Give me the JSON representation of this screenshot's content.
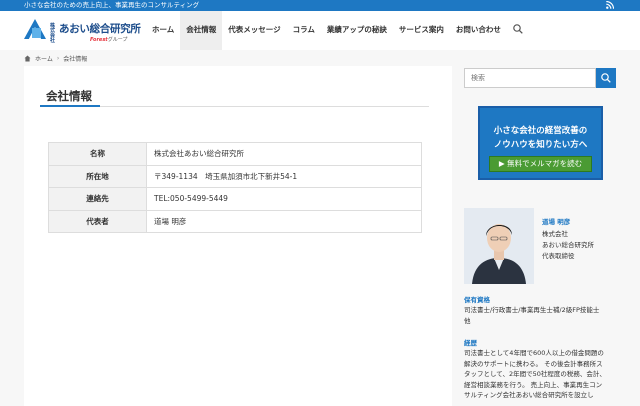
{
  "topbar": {
    "tagline": "小さな会社のための売上向上、事業再生のコンサルティング"
  },
  "logo": {
    "corp": "株式会社",
    "name": "あおい総合研究所",
    "group_brand": "Forest",
    "group_suffix": "グループ"
  },
  "nav": {
    "items": [
      {
        "label": "ホーム"
      },
      {
        "label": "会社情報",
        "active": true
      },
      {
        "label": "代表メッセージ"
      },
      {
        "label": "コラム"
      },
      {
        "label": "業績アップの秘訣"
      },
      {
        "label": "サービス案内"
      },
      {
        "label": "お問い合わせ"
      }
    ]
  },
  "breadcrumb": {
    "home": "ホーム",
    "current": "会社情報"
  },
  "page": {
    "title": "会社情報"
  },
  "info": {
    "rows": [
      {
        "key": "名称",
        "value": "株式会社あおい総合研究所"
      },
      {
        "key": "所在地",
        "value": "〒349-1134　埼玉県加須市北下新井54-1"
      },
      {
        "key": "連絡先",
        "value": "TEL:050-5499-5449"
      },
      {
        "key": "代表者",
        "value": "道場 明彦"
      }
    ]
  },
  "sidebar": {
    "search_placeholder": "検索",
    "banner": {
      "line1": "小さな会社の経営改善の",
      "line2": "ノウハウを知りたい方へ",
      "cta": "▶ 無料でメルマガを読む"
    },
    "profile": {
      "name": "道場 明彦",
      "line1": "株式会社",
      "line2": "あおい総合研究所",
      "line3": "代表取締役",
      "quals_title": "保有資格",
      "quals_1": "司法書士/行政書士/事業再生士補/2級FP技能士",
      "quals_2": "他",
      "career_title": "経歴",
      "career_1": "司法書士として4年間で600人以上の借金問題の",
      "career_2": "解決のサポートに携わる。 その後会計事務所ス",
      "career_3": "タッフとして、2年間で50社程度の税務、会計、",
      "career_4": "経営相談業務を行う。 売上向上、事業再生コン",
      "career_5": "サルティング会社あおい総合研究所を設立し"
    }
  },
  "colors": {
    "accent": "#1e78c3",
    "cta_green": "#4a9b33"
  }
}
